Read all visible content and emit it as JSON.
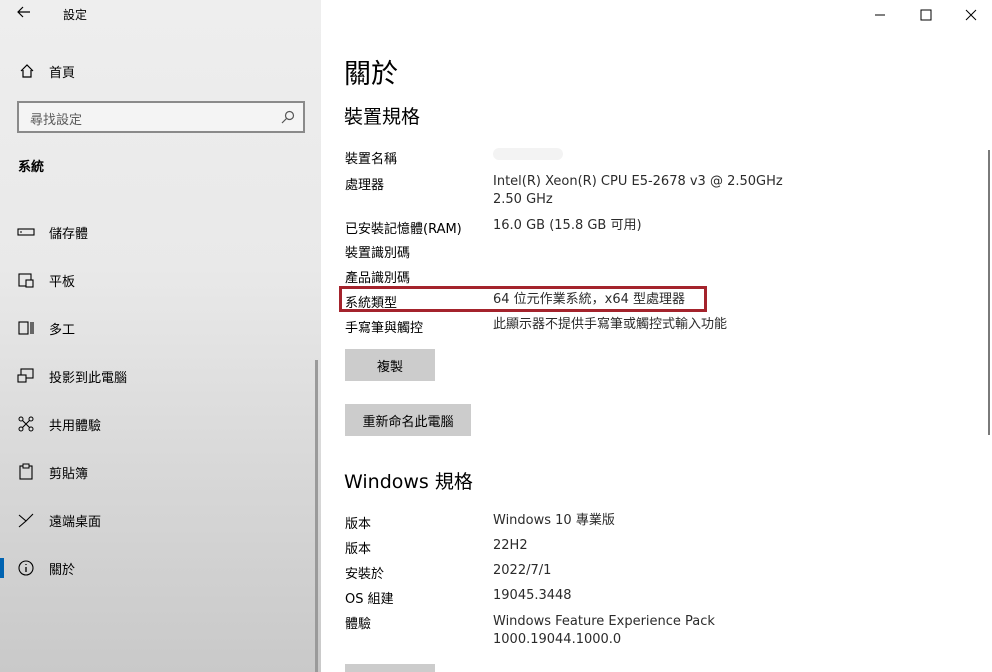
{
  "window": {
    "title": "設定"
  },
  "sidebar": {
    "home_label": "首頁",
    "search_placeholder": "尋找設定",
    "section_label": "系統",
    "items": [
      {
        "label": "儲存體",
        "icon": "storage-icon"
      },
      {
        "label": "平板",
        "icon": "tablet-icon"
      },
      {
        "label": "多工",
        "icon": "multitasking-icon"
      },
      {
        "label": "投影到此電腦",
        "icon": "projecting-icon"
      },
      {
        "label": "共用體驗",
        "icon": "shared-experiences-icon"
      },
      {
        "label": "剪貼簿",
        "icon": "clipboard-icon"
      },
      {
        "label": "遠端桌面",
        "icon": "remote-desktop-icon"
      },
      {
        "label": "關於",
        "icon": "about-icon",
        "active": true
      }
    ]
  },
  "main": {
    "title": "關於",
    "device_spec_heading": "裝置規格",
    "device_specs": [
      {
        "label": "裝置名稱",
        "value": ""
      },
      {
        "label": "處理器",
        "value": "Intel(R) Xeon(R) CPU E5-2678 v3 @ 2.50GHz",
        "value2": "2.50 GHz"
      },
      {
        "label": "已安裝記憶體(RAM)",
        "value": "16.0 GB (15.8 GB 可用)"
      },
      {
        "label": "裝置識別碼",
        "value": ""
      },
      {
        "label": "產品識別碼",
        "value": ""
      },
      {
        "label": "系統類型",
        "value": "64 位元作業系統，x64 型處理器"
      },
      {
        "label": "手寫筆與觸控",
        "value": "此顯示器不提供手寫筆或觸控式輸入功能"
      }
    ],
    "copy_button": "複製",
    "rename_button": "重新命名此電腦",
    "windows_spec_heading": "Windows 規格",
    "windows_specs": [
      {
        "label": "版本",
        "value": "Windows 10 專業版"
      },
      {
        "label": "版本",
        "value": "22H2"
      },
      {
        "label": "安裝於",
        "value": "2022/7/1"
      },
      {
        "label": "OS 組建",
        "value": "19045.3448"
      },
      {
        "label": "體驗",
        "value": "Windows Feature Experience Pack",
        "value2": "1000.19044.1000.0"
      }
    ]
  },
  "colors": {
    "accent": "#0063b1",
    "highlight": "#a4232c"
  }
}
